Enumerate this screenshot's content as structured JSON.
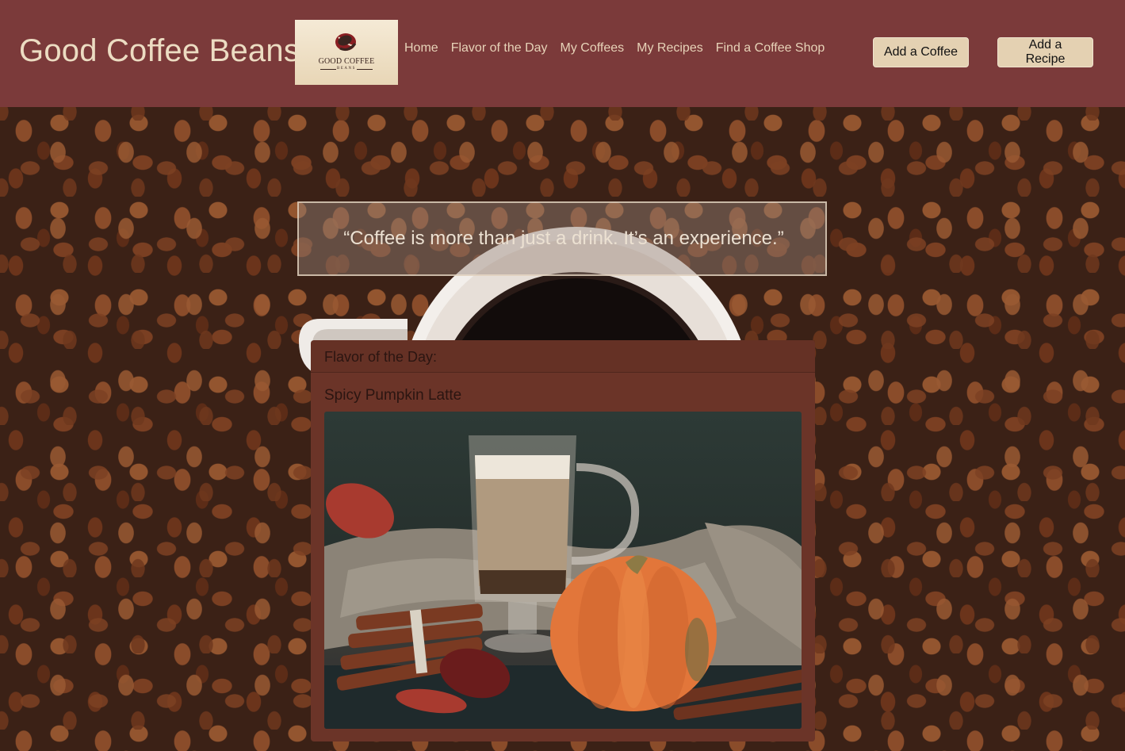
{
  "header": {
    "brand": "Good Coffee Beans",
    "logo": {
      "title": "GOOD COFFEE",
      "subtitle": "BEANS",
      "icon": "coffee-bean-icon"
    },
    "nav": [
      {
        "label": "Home"
      },
      {
        "label": "Flavor of the Day"
      },
      {
        "label": "My Coffees"
      },
      {
        "label": "My Recipes"
      },
      {
        "label": "Find a Coffee Shop"
      }
    ],
    "buttons": {
      "add_coffee": "Add a Coffee",
      "add_recipe": "Add a Recipe"
    }
  },
  "hero": {
    "quote": "“Coffee is more than just a drink. It’s an experience.”"
  },
  "flavor_card": {
    "header": "Flavor of the Day:",
    "title": "Spicy Pumpkin Latte"
  },
  "colors": {
    "navbar": "#7b3a3a",
    "brand_text": "#ecdcc2",
    "nav_text": "#e7d3b8",
    "button_bg": "#e4d1b2",
    "card_bg": "#6b3428"
  }
}
